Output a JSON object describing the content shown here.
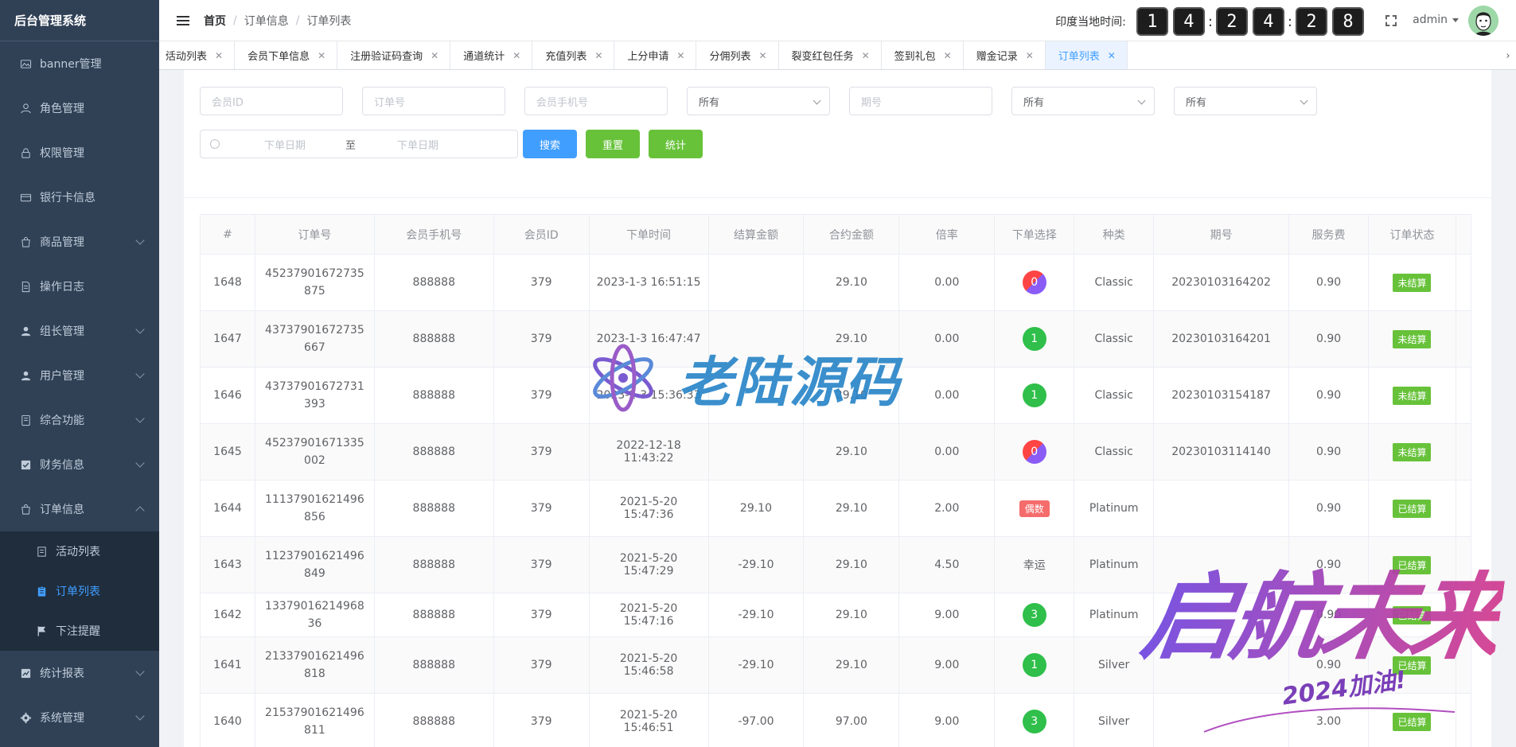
{
  "sidebar": {
    "logo": "后台管理系统",
    "items": [
      {
        "label": "banner管理"
      },
      {
        "label": "角色管理"
      },
      {
        "label": "权限管理"
      },
      {
        "label": "银行卡信息"
      },
      {
        "label": "商品管理"
      },
      {
        "label": "操作日志"
      },
      {
        "label": "组长管理"
      },
      {
        "label": "用户管理"
      },
      {
        "label": "综合功能"
      },
      {
        "label": "财务信息"
      },
      {
        "label": "订单信息"
      },
      {
        "label": "统计报表"
      },
      {
        "label": "系统管理"
      }
    ],
    "submenu": [
      {
        "label": "活动列表"
      },
      {
        "label": "订单列表"
      },
      {
        "label": "下注提醒"
      }
    ]
  },
  "header": {
    "breadcrumb": [
      "首页",
      "订单信息",
      "订单列表"
    ],
    "clock_label": "印度当地时间:",
    "clock_digits": [
      "1",
      "4",
      "2",
      "4",
      "2",
      "8"
    ],
    "user": "admin"
  },
  "tags": [
    {
      "label": "活动列表"
    },
    {
      "label": "会员下单信息"
    },
    {
      "label": "注册验证码查询"
    },
    {
      "label": "通道统计"
    },
    {
      "label": "充值列表"
    },
    {
      "label": "上分申请"
    },
    {
      "label": "分佣列表"
    },
    {
      "label": "裂变红包任务"
    },
    {
      "label": "签到礼包"
    },
    {
      "label": "赠金记录"
    },
    {
      "label": "订单列表"
    }
  ],
  "filters": {
    "member_id_placeholder": "会员ID",
    "order_no_placeholder": "订单号",
    "phone_placeholder": "会员手机号",
    "select1": "所有",
    "period_placeholder": "期号",
    "select2": "所有",
    "select3": "所有",
    "date_start_placeholder": "下单日期",
    "date_to": "至",
    "date_end_placeholder": "下单日期",
    "search_label": "搜索",
    "reset_label": "重置",
    "stats_label": "统计"
  },
  "table": {
    "columns": [
      "#",
      "订单号",
      "会员手机号",
      "会员ID",
      "下单时间",
      "结算金额",
      "合约金额",
      "倍率",
      "下单选择",
      "种类",
      "期号",
      "服务费",
      "订单状态"
    ],
    "rows": [
      {
        "id": "1648",
        "order_no": "45237901672735875",
        "phone": "888888",
        "member_id": "379",
        "time": "2023-1-3 16:51:15",
        "settle": "",
        "contract": "29.10",
        "rate": "0.00",
        "choice": "0",
        "choice_style": "grad",
        "kind": "Classic",
        "period": "20230103164202",
        "fee": "0.90",
        "status": "未结算"
      },
      {
        "id": "1647",
        "order_no": "43737901672735667",
        "phone": "888888",
        "member_id": "379",
        "time": "2023-1-3 16:47:47",
        "settle": "",
        "contract": "29.10",
        "rate": "0.00",
        "choice": "1",
        "choice_style": "green",
        "kind": "Classic",
        "period": "20230103164201",
        "fee": "0.90",
        "status": "未结算"
      },
      {
        "id": "1646",
        "order_no": "43737901672731393",
        "phone": "888888",
        "member_id": "379",
        "time": "2023-1-3 15:36:33",
        "settle": "",
        "contract": "29.10",
        "rate": "0.00",
        "choice": "1",
        "choice_style": "green",
        "kind": "Classic",
        "period": "20230103154187",
        "fee": "0.90",
        "status": "未结算"
      },
      {
        "id": "1645",
        "order_no": "45237901671335002",
        "phone": "888888",
        "member_id": "379",
        "time": "2022-12-18 11:43:22",
        "settle": "",
        "contract": "29.10",
        "rate": "0.00",
        "choice": "0",
        "choice_style": "grad",
        "kind": "Classic",
        "period": "20230103114140",
        "fee": "0.90",
        "status": "未结算"
      },
      {
        "id": "1644",
        "order_no": "11137901621496856",
        "phone": "888888",
        "member_id": "379",
        "time": "2021-5-20 15:47:36",
        "settle": "29.10",
        "contract": "29.10",
        "rate": "2.00",
        "choice": "偶数",
        "choice_style": "pill",
        "kind": "Platinum",
        "period": "",
        "fee": "0.90",
        "status": "已结算"
      },
      {
        "id": "1643",
        "order_no": "11237901621496849",
        "phone": "888888",
        "member_id": "379",
        "time": "2021-5-20 15:47:29",
        "settle": "-29.10",
        "contract": "29.10",
        "rate": "4.50",
        "choice": "幸运",
        "choice_style": "text",
        "kind": "Platinum",
        "period": "",
        "fee": "0.90",
        "status": "已结算"
      },
      {
        "id": "1642",
        "order_no": "1337901621496836",
        "phone": "888888",
        "member_id": "379",
        "time": "2021-5-20 15:47:16",
        "settle": "-29.10",
        "contract": "29.10",
        "rate": "9.00",
        "choice": "3",
        "choice_style": "green",
        "kind": "Platinum",
        "period": "",
        "fee": "0.90",
        "status": "已结算"
      },
      {
        "id": "1641",
        "order_no": "21337901621496818",
        "phone": "888888",
        "member_id": "379",
        "time": "2021-5-20 15:46:58",
        "settle": "-29.10",
        "contract": "29.10",
        "rate": "9.00",
        "choice": "1",
        "choice_style": "green",
        "kind": "Silver",
        "period": "",
        "fee": "0.90",
        "status": "已结算"
      },
      {
        "id": "1640",
        "order_no": "21537901621496811",
        "phone": "888888",
        "member_id": "379",
        "time": "2021-5-20 15:46:51",
        "settle": "-97.00",
        "contract": "97.00",
        "rate": "9.00",
        "choice": "3",
        "choice_style": "green",
        "kind": "Silver",
        "period": "",
        "fee": "3.00",
        "status": "已结算"
      }
    ]
  },
  "watermarks": {
    "wm1": "老陆源码",
    "wm2_big": "启航未来",
    "wm2_small": "2024加油!"
  }
}
